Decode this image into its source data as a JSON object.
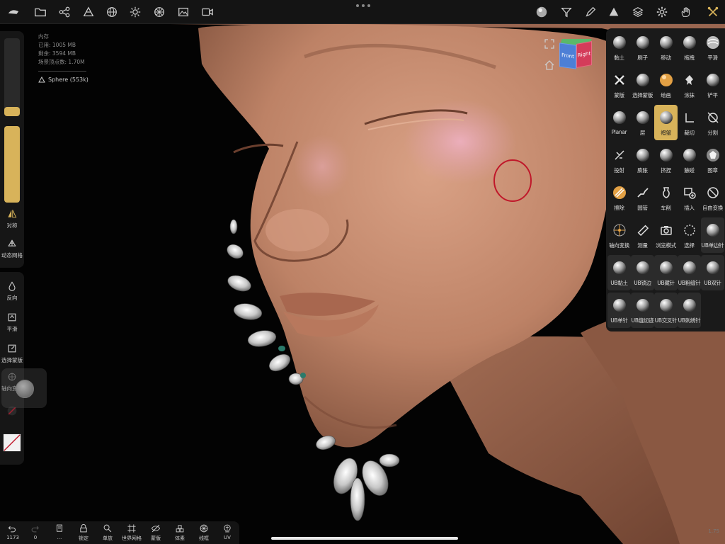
{
  "top_toolbar": {
    "left_icons": [
      "nomad-logo-icon",
      "folder-icon",
      "scene-graph-icon",
      "mesh-tool-icon",
      "globe-icon",
      "sun-icon",
      "material-ball-icon",
      "image-icon",
      "video-icon"
    ],
    "right_icons": [
      "material-preview-icon",
      "filter-icon",
      "pen-icon",
      "triangle-icon",
      "layers-icon",
      "gear-icon",
      "hand-icon",
      "tools-icon"
    ]
  },
  "memory": {
    "title": "内存",
    "used": "已用: 1005 MB",
    "remaining": "剩余: 3594 MB",
    "scene_vertices": "场景顶点数: 1.70M",
    "mesh_name": "Sphere (553k)"
  },
  "left_sidebar": {
    "symmetry": "对称",
    "dynamic_mesh": "动态网格",
    "invert": "反向",
    "smooth": "平滑",
    "select_mask": "选择蒙版",
    "axis_transform": "轴向变换",
    "brush_radius": 0.12,
    "brush_intensity": 0.45
  },
  "bottom_toolbar": {
    "items": [
      {
        "label": "1173",
        "icon": "undo-icon"
      },
      {
        "label": "0",
        "icon": "redo-icon"
      },
      {
        "label": "...",
        "icon": "book-icon"
      },
      {
        "label": "锁定",
        "icon": "lock-icon"
      },
      {
        "label": "单放",
        "icon": "zoom-icon"
      },
      {
        "label": "世界网格",
        "icon": "grid-icon"
      },
      {
        "label": "蒙版",
        "icon": "eye-off-icon"
      },
      {
        "label": "体素",
        "icon": "voxel-icon"
      },
      {
        "label": "线框",
        "icon": "wireframe-icon"
      },
      {
        "label": "UV",
        "icon": "uv-icon"
      }
    ]
  },
  "brush_panel": {
    "brushes": [
      {
        "label": "黏土",
        "icon": "clay-brush-icon"
      },
      {
        "label": "刷子",
        "icon": "brush-icon"
      },
      {
        "label": "移动",
        "icon": "move-brush-icon"
      },
      {
        "label": "拖拽",
        "icon": "drag-brush-icon"
      },
      {
        "label": "平滑",
        "icon": "smooth-brush-icon"
      },
      {
        "label": "蒙版",
        "icon": "mask-brush-icon"
      },
      {
        "label": "选择蒙版",
        "icon": "select-mask-brush-icon"
      },
      {
        "label": "绘画",
        "icon": "paint-brush-icon"
      },
      {
        "label": "涂抹",
        "icon": "smudge-brush-icon"
      },
      {
        "label": "铲平",
        "icon": "flatten-brush-icon"
      },
      {
        "label": "Planar",
        "icon": "planar-brush-icon"
      },
      {
        "label": "层",
        "icon": "layer-brush-icon"
      },
      {
        "label": "褶皱",
        "icon": "crease-brush-icon",
        "active": true
      },
      {
        "label": "裁切",
        "icon": "trim-brush-icon"
      },
      {
        "label": "分割",
        "icon": "split-brush-icon"
      },
      {
        "label": "投射",
        "icon": "project-brush-icon"
      },
      {
        "label": "膨胀",
        "icon": "inflate-brush-icon"
      },
      {
        "label": "挤捏",
        "icon": "pinch-brush-icon"
      },
      {
        "label": "触碰",
        "icon": "twist-brush-icon"
      },
      {
        "label": "图章",
        "icon": "stamp-brush-icon"
      },
      {
        "label": "擦除",
        "icon": "delete-brush-icon"
      },
      {
        "label": "圆管",
        "icon": "tube-brush-icon"
      },
      {
        "label": "车削",
        "icon": "lathe-brush-icon"
      },
      {
        "label": "插入",
        "icon": "insert-brush-icon"
      },
      {
        "label": "自由变换",
        "icon": "transform-brush-icon"
      },
      {
        "label": "轴向变换",
        "icon": "gizmo-brush-icon"
      },
      {
        "label": "测量",
        "icon": "ruler-brush-icon"
      },
      {
        "label": "浏览模式",
        "icon": "camera-brush-icon"
      },
      {
        "label": "选择",
        "icon": "select-brush-icon"
      },
      {
        "label": "UB单边针",
        "icon": "ub-brush-icon",
        "ub": true
      },
      {
        "label": "UB黏土",
        "icon": "ub-brush-icon",
        "ub": true
      },
      {
        "label": "UB锁边",
        "icon": "ub-brush-icon",
        "ub": true
      },
      {
        "label": "UB藏针",
        "icon": "ub-brush-icon",
        "ub": true
      },
      {
        "label": "UB粗缝针",
        "icon": "ub-brush-icon",
        "ub": true
      },
      {
        "label": "UB双针",
        "icon": "ub-brush-icon",
        "ub": true
      },
      {
        "label": "UB单针",
        "icon": "ub-brush-icon",
        "ub": true
      },
      {
        "label": "UB缝纫迹",
        "icon": "ub-brush-icon",
        "ub": true
      },
      {
        "label": "UB交叉针",
        "icon": "ub-brush-icon",
        "ub": true
      },
      {
        "label": "UB刺绣针",
        "icon": "ub-brush-icon",
        "ub": true
      }
    ]
  },
  "view_cube": {
    "front": "Front",
    "right": "Right"
  },
  "version": "1.75",
  "colors": {
    "accent": "#d8b35a",
    "skin": "#c58a6c",
    "cursor": "#c0182a"
  }
}
